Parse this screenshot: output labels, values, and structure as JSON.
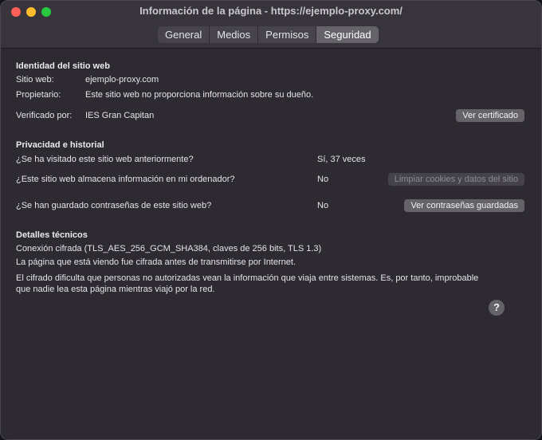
{
  "window": {
    "title": "Información de la página - https://ejemplo-proxy.com/",
    "tabs": [
      {
        "label": "General"
      },
      {
        "label": "Medios"
      },
      {
        "label": "Permisos"
      },
      {
        "label": "Seguridad"
      }
    ],
    "active_tab": "Seguridad"
  },
  "identity": {
    "heading": "Identidad del sitio web",
    "site_label": "Sitio web:",
    "site_value": "ejemplo-proxy.com",
    "owner_label": "Propietario:",
    "owner_value": "Este sitio web no proporciona información sobre su dueño.",
    "verified_label": "Verificado por:",
    "verified_value": "IES Gran Capitan",
    "view_cert_button": "Ver certificado"
  },
  "privacy": {
    "heading": "Privacidad e historial",
    "visited_question": "¿Se ha visitado este sitio web anteriormente?",
    "visited_answer": "Sí, 37 veces",
    "storage_question": "¿Este sitio web almacena información en mi ordenador?",
    "storage_answer": "No",
    "clear_button": "Limpiar cookies y datos del sitio",
    "passwords_question": "¿Se han guardado contraseñas de este sitio web?",
    "passwords_answer": "No",
    "view_passwords_button": "Ver contraseñas guardadas"
  },
  "technical": {
    "heading": "Detalles técnicos",
    "connection": "Conexión cifrada (TLS_AES_256_GCM_SHA384, claves de 256 bits, TLS 1.3)",
    "encrypted_note": "La página que está viendo fue cifrada antes de transmitirse por Internet.",
    "explanation_line1": "El cifrado dificulta que personas no autorizadas vean la información que viaja entre sistemas. Es, por tanto, improbable",
    "explanation_line2": "que nadie lea esta página mientras viajó por la red."
  },
  "help": {
    "label": "?"
  }
}
